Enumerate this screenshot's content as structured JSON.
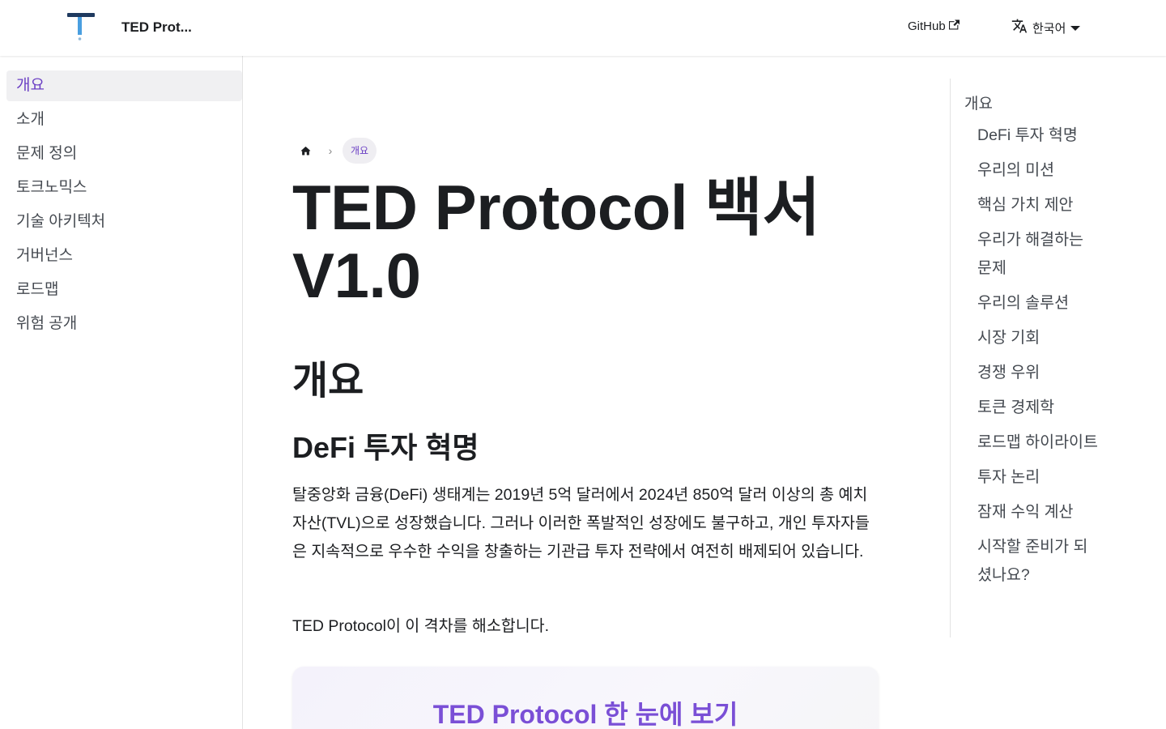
{
  "navbar": {
    "brand_title": "TED Prot...",
    "github_label": "GitHub",
    "lang_label": "한국어"
  },
  "sidebar": {
    "items": [
      {
        "label": "개요",
        "active": true
      },
      {
        "label": "소개"
      },
      {
        "label": "문제 정의"
      },
      {
        "label": "토크노믹스"
      },
      {
        "label": "기술 아키텍처"
      },
      {
        "label": "거버넌스"
      },
      {
        "label": "로드맵"
      },
      {
        "label": "위험 공개"
      }
    ]
  },
  "main": {
    "breadcrumb_current": "개요",
    "title": "TED Protocol 백서 V1.0",
    "h2": "개요",
    "h3": "DeFi 투자 혁명",
    "paragraph": "탈중앙화 금융(DeFi) 생태계는 2019년 5억 달러에서 2024년 850억 달러 이상의 총 예치 자산(TVL)으로 성장했습니다. 그러나 이러한 폭발적인 성장에도 불구하고, 개인 투자자들은 지속적으로 우수한 수익을 창출하는 기관급 투자 전략에서 여전히 배제되어 있습니다.",
    "paragraph2": "TED Protocol이 이 격차를 해소합니다.",
    "card_title": "TED Protocol 한 눈에 보기"
  },
  "toc": {
    "top": "개요",
    "items": [
      "DeFi 투자 혁명",
      "우리의 미션",
      "핵심 가치 제안",
      "우리가 해결하는 문제",
      "우리의 솔루션",
      "시장 기회",
      "경쟁 우위",
      "토큰 경제학",
      "로드맵 하이라이트",
      "투자 논리",
      "잠재 수익 계산",
      "시작할 준비가 되셨나요?"
    ]
  },
  "colors": {
    "accent": "#6b3fc4",
    "logo_blue": "#4a9fe0",
    "logo_dark": "#1f3a5f"
  }
}
